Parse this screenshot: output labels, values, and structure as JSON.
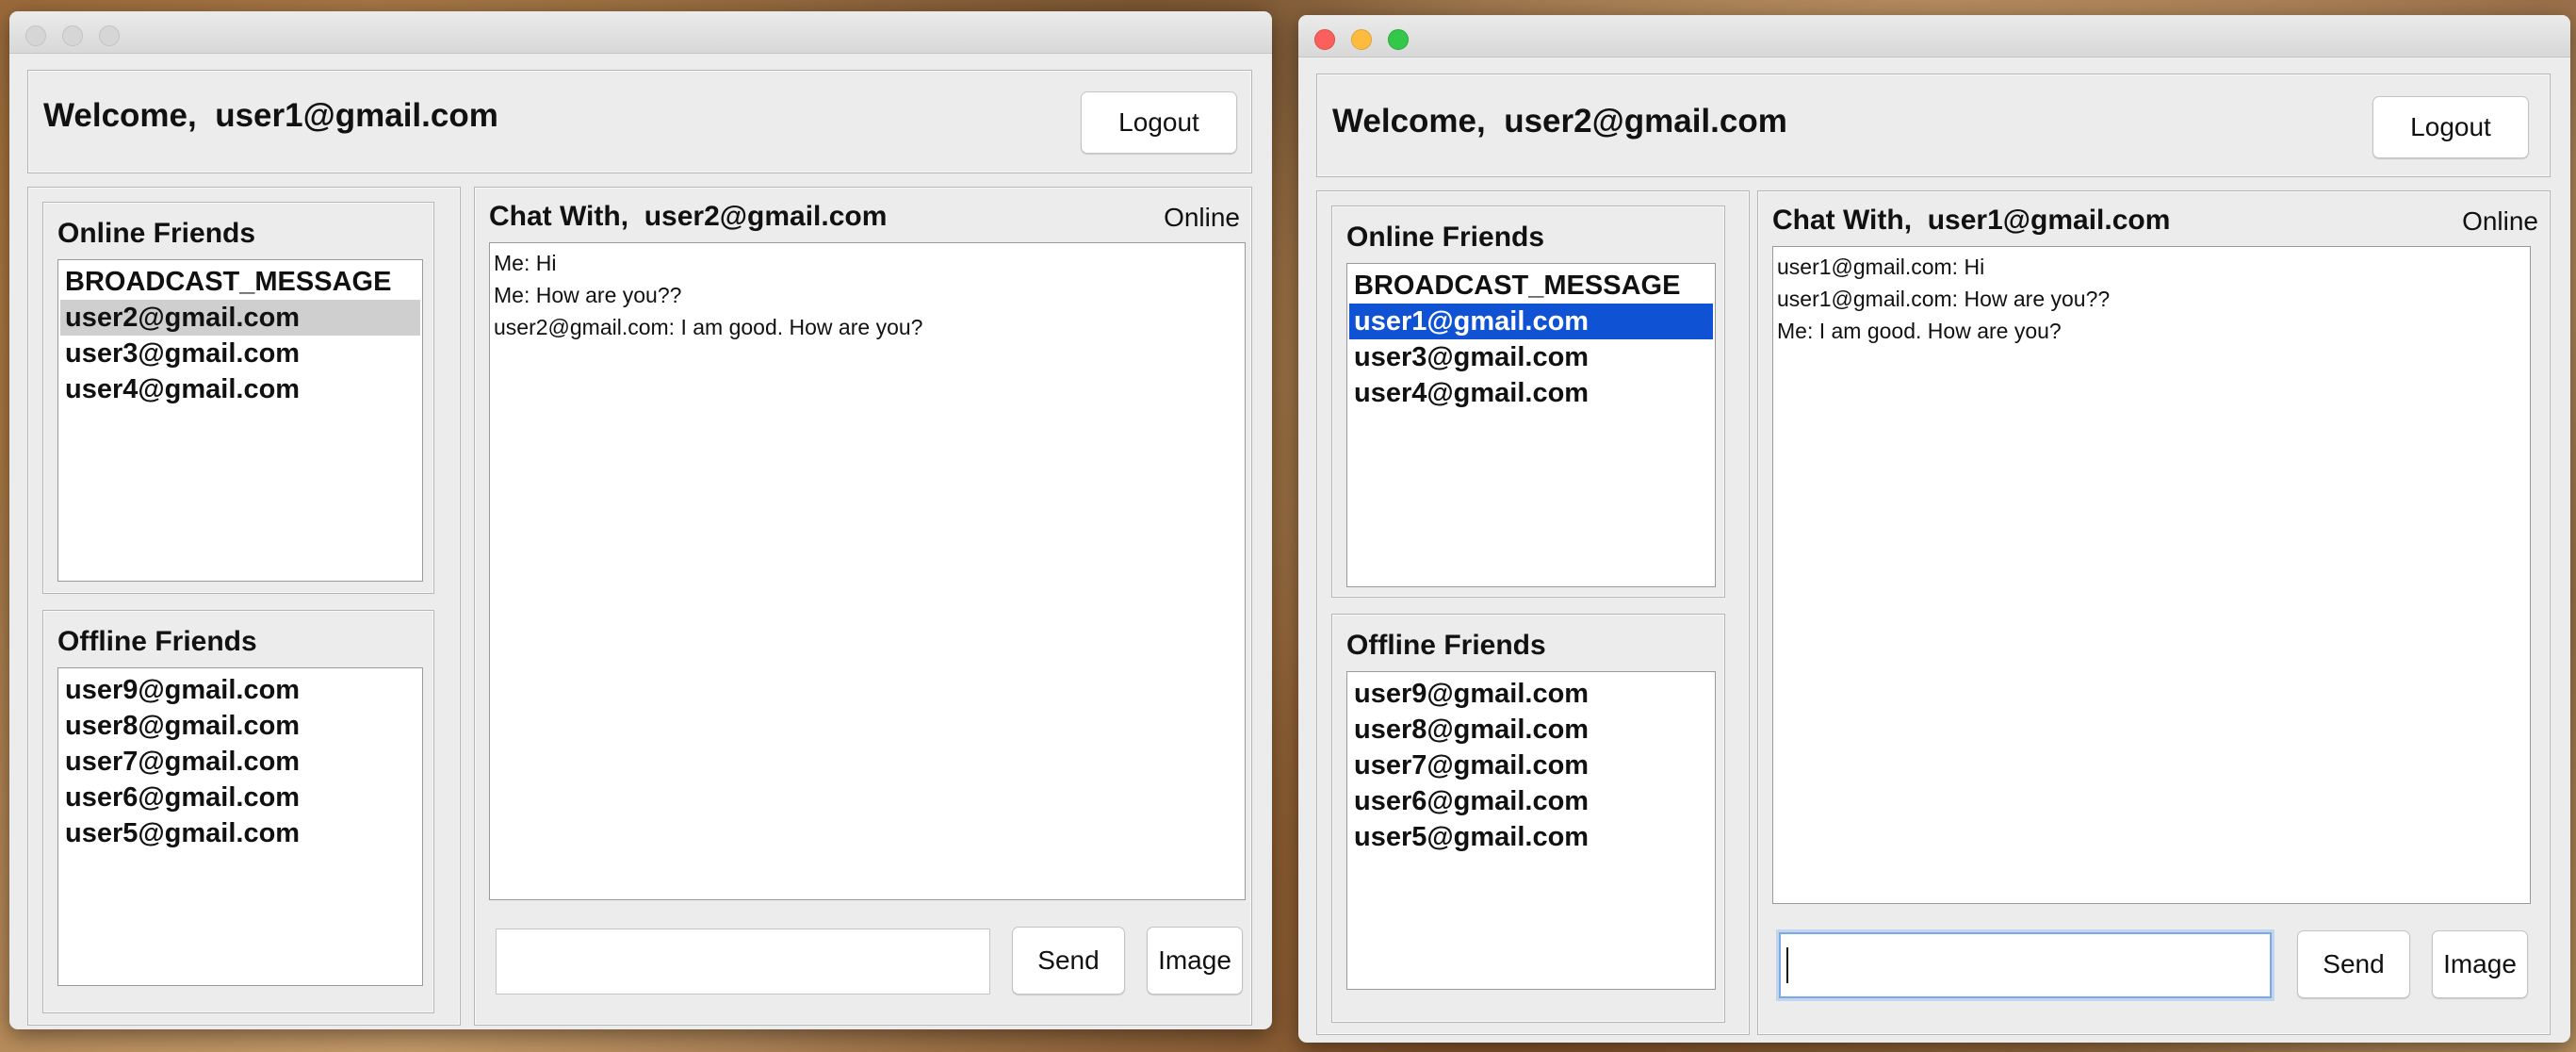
{
  "windows": [
    {
      "welcome_label": "Welcome,",
      "user": "user1@gmail.com",
      "logout_label": "Logout",
      "online_title": "Online Friends",
      "online": [
        "BROADCAST_MESSAGE",
        "user2@gmail.com",
        "user3@gmail.com",
        "user4@gmail.com"
      ],
      "online_selected": "user2@gmail.com",
      "offline_title": "Offline Friends",
      "offline": [
        "user9@gmail.com",
        "user8@gmail.com",
        "user7@gmail.com",
        "user6@gmail.com",
        "user5@gmail.com"
      ],
      "chat_with_label": "Chat With,",
      "chat_with": "user2@gmail.com",
      "chat_status": "Online",
      "messages": [
        "Me: Hi",
        "Me: How are you??",
        "user2@gmail.com: I am good. How are you?"
      ],
      "input_value": "",
      "send_label": "Send",
      "image_label": "Image"
    },
    {
      "welcome_label": "Welcome,",
      "user": "user2@gmail.com",
      "logout_label": "Logout",
      "online_title": "Online Friends",
      "online": [
        "BROADCAST_MESSAGE",
        "user1@gmail.com",
        "user3@gmail.com",
        "user4@gmail.com"
      ],
      "online_selected": "user1@gmail.com",
      "offline_title": "Offline Friends",
      "offline": [
        "user9@gmail.com",
        "user8@gmail.com",
        "user7@gmail.com",
        "user6@gmail.com",
        "user5@gmail.com"
      ],
      "chat_with_label": "Chat With,",
      "chat_with": "user1@gmail.com",
      "chat_status": "Online",
      "messages": [
        "user1@gmail.com: Hi",
        "user1@gmail.com: How are you??",
        "Me: I am good. How are you?"
      ],
      "input_value": "",
      "send_label": "Send",
      "image_label": "Image"
    }
  ],
  "colors": {
    "selection_active": "#0f52d4",
    "selection_inactive": "#cfcfcf"
  }
}
